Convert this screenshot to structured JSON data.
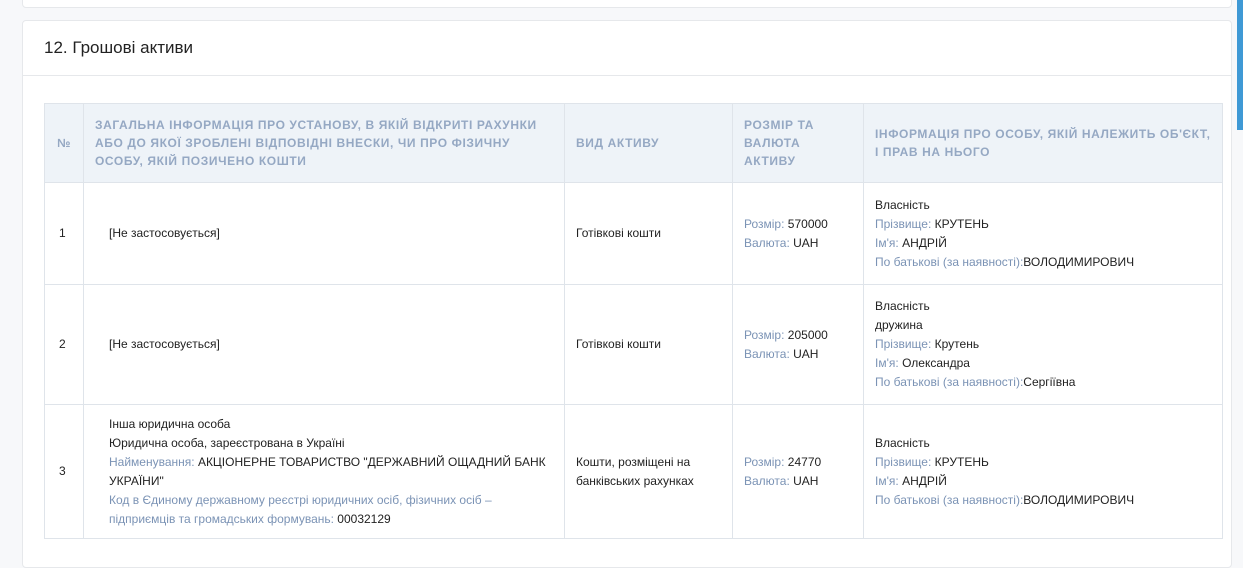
{
  "section": {
    "title": "12. Грошові активи"
  },
  "table": {
    "headers": {
      "num": "№",
      "institution": "Загальна інформація про установу, в якій відкриті рахунки або до якої зроблені відповідні внески, чи про фізичну особу, якій позичено кошти",
      "asset_type": "Вид активу",
      "amount": "Розмір та валюта активу",
      "owner": "Інформація про особу, якій належить об'єкт, і прав на нього"
    },
    "labels": {
      "size": "Розмір:",
      "currency": "Валюта:",
      "surname": "Прізвище:",
      "name": "Ім'я:",
      "patronymic": "По батькові (за наявності):",
      "org_name": "Найменування:",
      "edr_code": "Код в Єдиному державному реєстрі юридичних осіб, фізичних осіб – підприємців та громадських формувань:"
    },
    "rows": [
      {
        "num": "1",
        "institution": "[Не застосовується]",
        "asset_type": "Готівкові кошти",
        "size": "570000",
        "currency": "UAH",
        "ownership": "Власність",
        "surname": "КРУТЕНЬ",
        "name": "АНДРІЙ",
        "patronymic": "ВОЛОДИМИРОВИЧ"
      },
      {
        "num": "2",
        "institution": "[Не застосовується]",
        "asset_type": "Готівкові кошти",
        "size": "205000",
        "currency": "UAH",
        "ownership": "Власність",
        "relation": "дружина",
        "surname": "Крутень",
        "name": "Олександра",
        "patronymic": "Сергіївна"
      },
      {
        "num": "3",
        "institution_type": "Інша юридична особа",
        "institution_reg": "Юридична особа, зареєстрована в Україні",
        "org_name": "АКЦІОНЕРНЕ ТОВАРИСТВО \"ДЕРЖАВНИЙ ОЩАДНИЙ БАНК УКРАЇНИ\"",
        "edr_code": "00032129",
        "asset_type": "Кошти, розміщені на банківських рахунках",
        "size": "24770",
        "currency": "UAH",
        "ownership": "Власність",
        "surname": "КРУТЕНЬ",
        "name": "АНДРІЙ",
        "patronymic": "ВОЛОДИМИРОВИЧ"
      }
    ]
  }
}
